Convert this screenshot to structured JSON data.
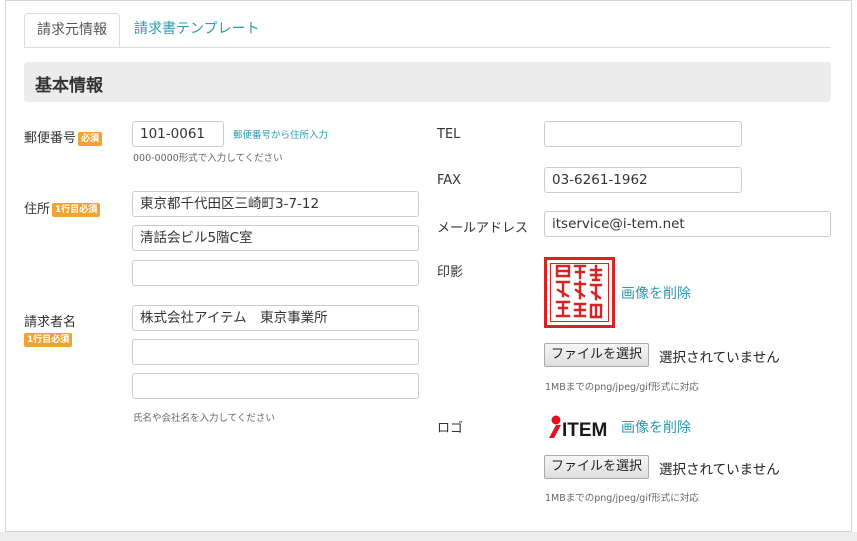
{
  "tabs": [
    {
      "label": "請求元情報",
      "active": true
    },
    {
      "label": "請求書テンプレート",
      "active": false
    }
  ],
  "section_title": "基本情報",
  "required_badge": "必須",
  "first_line_required_badge": "1行目必須",
  "postal": {
    "label": "郵便番号",
    "value": "101-0061",
    "lookup_link": "郵便番号から住所入力",
    "hint": "000-0000形式で入力してください"
  },
  "address": {
    "label": "住所",
    "lines": [
      "東京都千代田区三崎町3-7-12",
      "清話会ビル5階C室",
      ""
    ]
  },
  "billing_name": {
    "label": "請求者名",
    "lines": [
      "株式会社アイテム　東京事業所",
      "",
      ""
    ],
    "hint": "氏名や会社名を入力してください"
  },
  "tel": {
    "label": "TEL",
    "value": ""
  },
  "fax": {
    "label": "FAX",
    "value": "03-6261-1962"
  },
  "email": {
    "label": "メールアドレス",
    "value": "itservice@i-tem.net"
  },
  "seal": {
    "label": "印影",
    "delete_link": "画像を削除",
    "file_button": "ファイルを選択",
    "file_status": "選択されていません",
    "hint": "1MBまでのpng/jpeg/gif形式に対応"
  },
  "logo": {
    "label": "ロゴ",
    "logo_text": "ITEM",
    "delete_link": "画像を削除",
    "file_button": "ファイルを選択",
    "file_status": "選択されていません",
    "hint": "1MBまでのpng/jpeg/gif形式に対応"
  },
  "colors": {
    "accent": "#2a9cb0",
    "badge": "#f0a331",
    "seal_red": "#d42424"
  }
}
